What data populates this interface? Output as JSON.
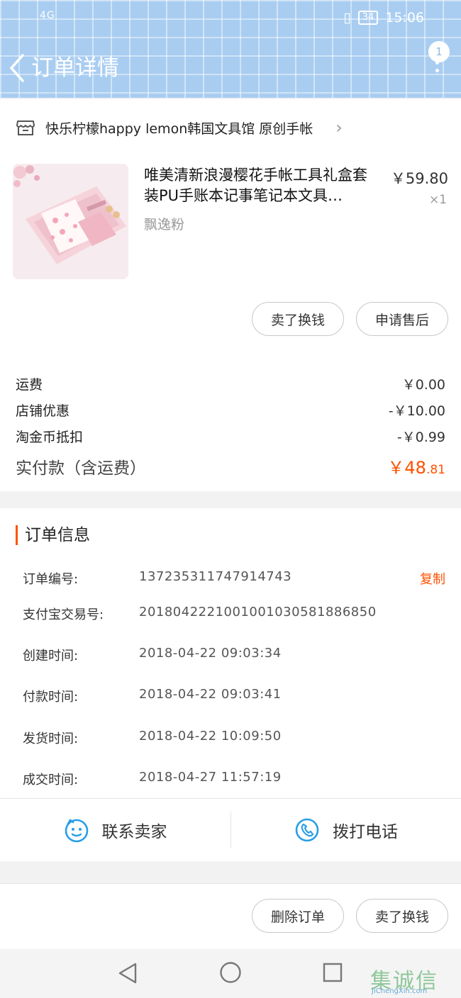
{
  "status_bar": {
    "signal": "4G",
    "battery": "34",
    "time": "15:06"
  },
  "header": {
    "title": "订单详情",
    "notification_count": "1"
  },
  "store": {
    "name": "快乐柠檬happy lemon韩国文具馆 原创手帐"
  },
  "product": {
    "title": "唯美清新浪漫樱花手帐工具礼盒套装PU手账本记事笔记本文具…",
    "price": "￥59.80",
    "quantity": "×1",
    "sku": "飘逸粉"
  },
  "item_actions": {
    "sell_label": "卖了换钱",
    "after_sale_label": "申请售后"
  },
  "fees": [
    {
      "label": "运费",
      "value": "￥0.00"
    },
    {
      "label": "店铺优惠",
      "value": "-￥10.00"
    },
    {
      "label": "淘金币抵扣",
      "value": "-￥0.99"
    }
  ],
  "total": {
    "label": "实付款（含运费）",
    "int": "￥48",
    "dec": ".81"
  },
  "order_info": {
    "title": "订单信息",
    "copy_label": "复制",
    "rows": [
      {
        "label": "订单编号:",
        "value": "137235311747914743"
      },
      {
        "label": "支付宝交易号:",
        "value": "2018042221001001030581886850"
      },
      {
        "label": "创建时间:",
        "value": "2018-04-22 09:03:34"
      },
      {
        "label": "付款时间:",
        "value": "2018-04-22 09:03:41"
      },
      {
        "label": "发货时间:",
        "value": "2018-04-22 10:09:50"
      },
      {
        "label": "成交时间:",
        "value": "2018-04-27 11:57:19"
      }
    ]
  },
  "contact": {
    "seller_label": "联系卖家",
    "phone_label": "拨打电话"
  },
  "bottom_actions": {
    "delete_label": "删除订单",
    "sell_label": "卖了换钱"
  },
  "watermark": {
    "text": "集诚信",
    "sub": "JiChengXin.com"
  },
  "colors": {
    "accent": "#ff5000",
    "header": "#a9cdf1",
    "icon_blue": "#2a9ee8"
  }
}
